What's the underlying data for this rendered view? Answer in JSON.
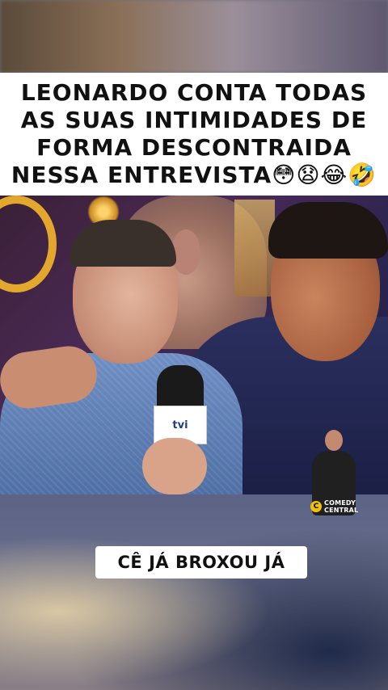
{
  "caption": {
    "text": "LEONARDO CONTA TODAS AS SUAS INTIMIDADES DE FORMA DESCONTRAIDA NESSA ENTREVISTA😳😧😂🤣"
  },
  "video": {
    "mic_logo": "tvi",
    "watermark": {
      "brand_line1": "COMEDY",
      "brand_line2": "CENTRAL",
      "icon": "cc-icon"
    }
  },
  "subtitle": {
    "text": "CÊ JÁ BROXOU JÁ"
  }
}
